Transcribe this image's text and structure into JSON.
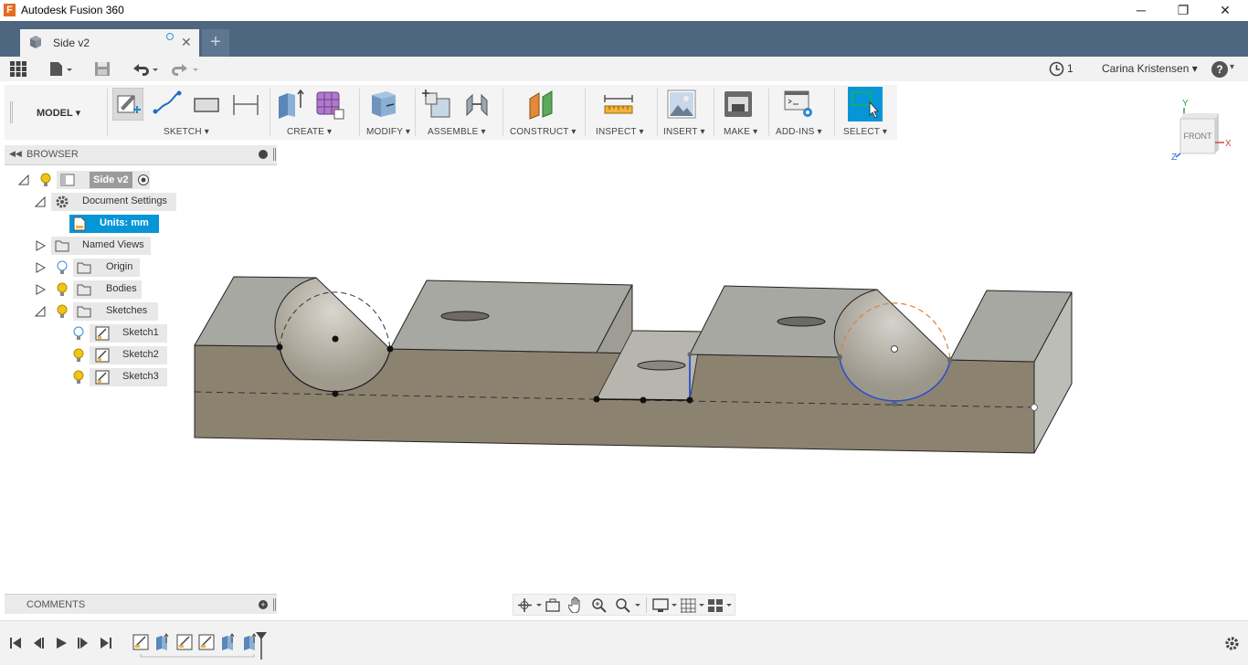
{
  "window": {
    "title": "Autodesk Fusion 360",
    "logo_letter": "F",
    "controls": {
      "minimize": "─",
      "maximize": "❐",
      "close": "✕"
    }
  },
  "tabs": {
    "active": {
      "label": "Side v2",
      "close": "✕"
    },
    "new_tab": "+"
  },
  "quick_access": {
    "job_count": "1",
    "user": "Carina Kristensen",
    "user_caret": "▾",
    "help": "?"
  },
  "ribbon": {
    "workspace": "MODEL",
    "groups": [
      {
        "label": "SKETCH ▾"
      },
      {
        "label": "CREATE ▾"
      },
      {
        "label": "MODIFY ▾"
      },
      {
        "label": "ASSEMBLE ▾"
      },
      {
        "label": "CONSTRUCT ▾"
      },
      {
        "label": "INSPECT ▾"
      },
      {
        "label": "INSERT ▾"
      },
      {
        "label": "MAKE ▾"
      },
      {
        "label": "ADD-INS ▾"
      },
      {
        "label": "SELECT ▾"
      }
    ]
  },
  "browser": {
    "header": "BROWSER",
    "items": [
      {
        "label": "Side v2"
      },
      {
        "label": "Document Settings"
      },
      {
        "label": "Units: mm"
      },
      {
        "label": "Named Views"
      },
      {
        "label": "Origin"
      },
      {
        "label": "Bodies"
      },
      {
        "label": "Sketches"
      },
      {
        "label": "Sketch1"
      },
      {
        "label": "Sketch2"
      },
      {
        "label": "Sketch3"
      }
    ]
  },
  "comments": {
    "header": "COMMENTS"
  },
  "viewcube": {
    "face": "FRONT",
    "axes": {
      "x": "X",
      "y": "Y",
      "z": "Z"
    }
  },
  "colors": {
    "tab_bar": "#4e6680",
    "selection": "#0696d7",
    "body_front": "#8c8270",
    "body_top": "#a8a8a2"
  }
}
